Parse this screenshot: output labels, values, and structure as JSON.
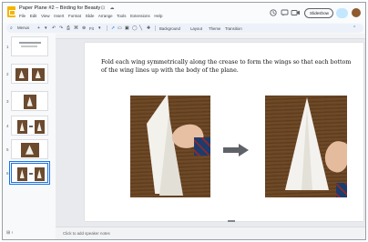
{
  "app": {
    "title": "Paper Plane #2 – Birding for Beauty",
    "title_icons": "☆ ⊡ ☁",
    "menu": [
      "File",
      "Edit",
      "View",
      "Insert",
      "Format",
      "Slide",
      "Arrange",
      "Tools",
      "Extensions",
      "Help"
    ],
    "slideshow_label": "Slideshow",
    "icons": [
      "history-icon",
      "comment-icon",
      "video-call-icon"
    ]
  },
  "toolbar": {
    "search_label": "Menus",
    "items": [
      "Background",
      "Layout",
      "Theme",
      "Transition"
    ],
    "zoom_label": "Fit"
  },
  "filmstrip": {
    "slides": [
      {
        "num": "1"
      },
      {
        "num": "2"
      },
      {
        "num": "3"
      },
      {
        "num": "4"
      },
      {
        "num": "5"
      },
      {
        "num": "6"
      }
    ],
    "selected_index": 6
  },
  "slide": {
    "body_text": "Fold each wing symmetrically along the crease to form the wings so that each bottom of the wing lines up with the body of the plane."
  },
  "notes": {
    "placeholder": "Click to add speaker notes"
  },
  "colors": {
    "accent": "#1a73e8",
    "toolbar_bg": "#edf2fa",
    "share_bg": "#c2e7ff",
    "arrow": "#5f6368"
  }
}
